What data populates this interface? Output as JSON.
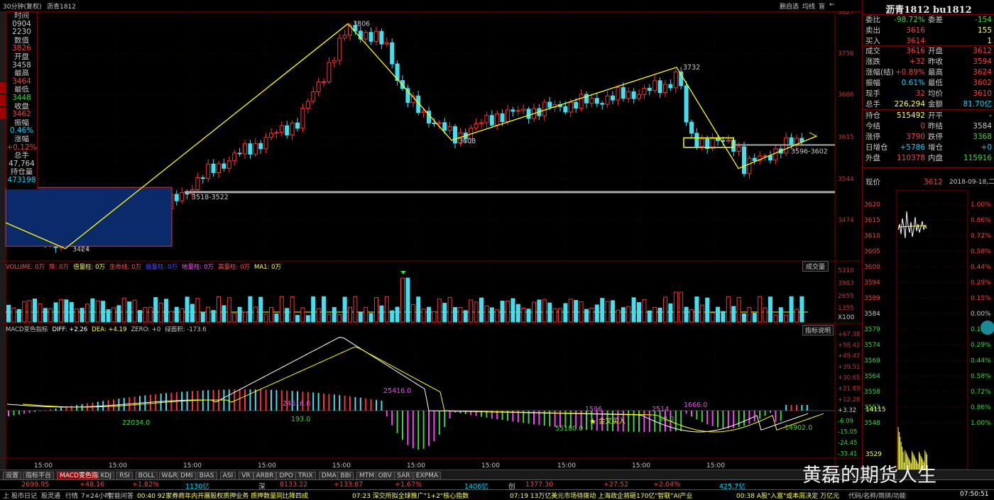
{
  "topbar": {
    "period": "30分钟(复权)",
    "symbol": "沥青1812",
    "buttons": [
      "删自选",
      "均线",
      "盲",
      "←"
    ]
  },
  "infobox": {
    "rows": [
      {
        "label": "时间",
        "value": "0904",
        "vcolor": "#c8c8c8"
      },
      {
        "label": "",
        "value": "2230",
        "vcolor": "#c8c8c8"
      },
      {
        "label": "数值",
        "value": "3826",
        "vcolor": "#ff3b3b"
      },
      {
        "label": "开盘",
        "value": "3458",
        "vcolor": "#c8c8c8"
      },
      {
        "label": "最高",
        "value": "3464",
        "vcolor": "#ff3b3b"
      },
      {
        "label": "最低",
        "value": "3448",
        "vcolor": "#38d838"
      },
      {
        "label": "收盘",
        "value": "3462",
        "vcolor": "#ff3b3b"
      },
      {
        "label": "振幅",
        "value": "0.46%",
        "vcolor": "#00d8ff"
      },
      {
        "label": "涨幅",
        "value": "+0.12%",
        "vcolor": "#ff3b3b"
      },
      {
        "label": "总手",
        "value": "47,764",
        "vcolor": "#c8c8c8"
      },
      {
        "label": "持仓量",
        "value": "473198",
        "vcolor": "#00d8ff"
      }
    ]
  },
  "price_axis": [
    "3827",
    "3756",
    "3686",
    "3615",
    "3544",
    "3474"
  ],
  "annotations": {
    "peak": "3806",
    "low1": "3424",
    "mid": "3608",
    "peak2": "3732",
    "support": "3518-3522",
    "range": "3596-3602"
  },
  "volume": {
    "legend": [
      {
        "t": "VOLUME: 0万",
        "c": "#ff5050"
      },
      {
        "t": "降: 0万",
        "c": "#ff5050"
      },
      {
        "t": "倍量柱: 0万",
        "c": "#ffff50"
      },
      {
        "t": "生命线: 0万",
        "c": "#ff5050"
      },
      {
        "t": "缩量柱: 0万",
        "c": "#5050ff"
      },
      {
        "t": "地量柱: 0万",
        "c": "#ff50ff"
      },
      {
        "t": "高量柱: 0万",
        "c": "#ff5050"
      },
      {
        "t": "MA1: 0万",
        "c": "#ffff50"
      }
    ],
    "axis": [
      "5310",
      "3983",
      "2655",
      "1355",
      "X100"
    ],
    "button": "成交量"
  },
  "macd": {
    "legend": [
      {
        "t": "MACD变色指标",
        "c": "#c8c8c8"
      },
      {
        "t": "DIFF: +2.26",
        "c": "#ffffff"
      },
      {
        "t": "DEA: +4.19",
        "c": "#ffff50"
      },
      {
        "t": "ZERO: +0",
        "c": "#c8c8c8"
      },
      {
        "t": "绿面积: -173.6",
        "c": "#c8c8c8"
      }
    ],
    "axis": [
      "+67.38",
      "+58.42",
      "+49.47",
      "+39.51",
      "+30.65",
      "+21.69",
      "+12.28",
      "+3.32",
      "-6.09",
      "-15.05",
      "-24.45",
      "-33.41"
    ],
    "labels": [
      "22034.0",
      "193.0",
      "24616.0",
      "25416.0",
      "55180.0",
      "1596",
      "98.0",
      "2514",
      "1666.0",
      "14902.0"
    ],
    "signal": "金叉买入",
    "button": "指标说明"
  },
  "time_axis": [
    "15:00",
    "15:00",
    "15:00",
    "15:00",
    "15:00",
    "15:00",
    "15:00",
    "15:00",
    "15:00",
    "15:00"
  ],
  "quote": {
    "title": "沥青1812 bu1812",
    "rows1": [
      {
        "a": "委比",
        "av": "-98.72%",
        "avc": "#38d838",
        "b": "委差",
        "bv": "-154",
        "bvc": "#38d838"
      },
      {
        "a": "卖出",
        "av": "3616",
        "avc": "#ff3b3b",
        "b": "",
        "bv": "155",
        "bvc": "#ffff50"
      },
      {
        "a": "买入",
        "av": "3614",
        "avc": "#ff3b3b",
        "b": "",
        "bv": "1",
        "bvc": "#ffff50"
      }
    ],
    "rows2": [
      {
        "a": "成交",
        "av": "3616",
        "avc": "#ff3b3b",
        "b": "开盘",
        "bv": "3612",
        "bvc": "#ff3b3b"
      },
      {
        "a": "涨跌",
        "av": "+32",
        "avc": "#ff3b3b",
        "b": "昨收",
        "bv": "3594",
        "bvc": "#ff3b3b"
      },
      {
        "a": "涨幅(结)",
        "av": "+0.89%",
        "avc": "#ff3b3b",
        "b": "最高",
        "bv": "3624",
        "bvc": "#ff3b3b"
      },
      {
        "a": "振幅",
        "av": "0.61%",
        "avc": "#00d8ff",
        "b": "最低",
        "bv": "3602",
        "bvc": "#ff3b3b"
      },
      {
        "a": "现手",
        "av": "32",
        "avc": "#ff3b3b",
        "b": "均价",
        "bv": "3610",
        "bvc": "#ff3b3b"
      },
      {
        "a": "总手",
        "av": "226,294",
        "avc": "#ffff50",
        "b": "金额",
        "bv": "81.70亿",
        "bvc": "#00d8ff"
      }
    ],
    "rows3": [
      {
        "a": "持仓",
        "av": "515492",
        "avc": "#ffff50",
        "b": "开平",
        "bv": "-",
        "bvc": "#c8c8c8"
      },
      {
        "a": "今结",
        "av": "0",
        "avc": "#ff3b3b",
        "b": "昨结",
        "bv": "3584",
        "bvc": "#c8c8c8"
      },
      {
        "a": "涨停",
        "av": "3790",
        "avc": "#ff3b3b",
        "b": "跌停",
        "bv": "3368",
        "bvc": "#38d838"
      },
      {
        "a": "日增仓",
        "av": "+5786",
        "avc": "#00d8ff",
        "b": "增仓",
        "bv": "+0",
        "bvc": "#00d8ff"
      },
      {
        "a": "外盘",
        "av": "110378",
        "avc": "#ff3b3b",
        "b": "内盘",
        "bv": "115916",
        "bvc": "#38d838"
      }
    ],
    "xianxian": "现价",
    "xianxian_val": "3612",
    "date": "2018-09-18,二",
    "mini_left": [
      "3620",
      "3615",
      "3610",
      "3605",
      "3600",
      "3594",
      "3589",
      "3584",
      "3579",
      "3574",
      "3569",
      "3564",
      "3558",
      "3553",
      "3548"
    ],
    "mini_right": [
      "1.00%",
      "0.86%",
      "0.72%",
      "0.58%",
      "0.44%",
      "0.29%",
      "0.15%",
      "0.00%",
      "0.15%",
      "0.29%",
      "0.44%",
      "0.58%",
      "0.72%",
      "0.86%",
      "1.00%"
    ],
    "mini_vol": [
      "14115",
      "3529"
    ]
  },
  "tabs": [
    "设置",
    "指标平台",
    "MACD变色指标",
    "KDJ",
    "RSI",
    "BOLL",
    "W&R",
    "DMI",
    "BIAS",
    "ASI",
    "VR",
    "ARBR",
    "DPO",
    "TRIX",
    "DMA",
    "BBI",
    "MTM",
    "OBV",
    "SAR",
    "EXPMA"
  ],
  "ticker": [
    {
      "t": "2699.95",
      "c": "#ff3b3b"
    },
    {
      "t": "+48.16",
      "c": "#ff3b3b"
    },
    {
      "t": "+1.82%",
      "c": "#ff3b3b"
    },
    {
      "t": "1130亿",
      "c": "#00d8ff"
    },
    {
      "t": "深",
      "c": "#c8c8c8"
    },
    {
      "t": "8133.22",
      "c": "#ff3b3b"
    },
    {
      "t": "+133.87",
      "c": "#ff3b3b"
    },
    {
      "t": "+1.67%",
      "c": "#ff3b3b"
    },
    {
      "t": "1406亿",
      "c": "#00d8ff"
    },
    {
      "t": "创",
      "c": "#c8c8c8"
    },
    {
      "t": "1377.30",
      "c": "#ff3b3b"
    },
    {
      "t": "+27.52",
      "c": "#ff3b3b"
    },
    {
      "t": "+2.04%",
      "c": "#ff3b3b"
    },
    {
      "t": "425.7亿",
      "c": "#00d8ff"
    }
  ],
  "status": {
    "items": [
      "上",
      "股市日记",
      "股灵通",
      "行情",
      "7×24小时",
      "智能问答"
    ],
    "news": [
      "00:40 92家券商年内开展股权质押业务 质押数量同比降四成",
      "07:23 深交所拟全球推广\"1+2\"核心指数",
      "07:19 13万亿美元市场待拨动 上海政企将砸170亿\"智联\"AI产业",
      "00:38 A股\"入富\"或本周决定 万亿元"
    ],
    "right": "代码/名称/简拼/功能",
    "clock": "07:50:51"
  },
  "watermark": "黄磊的期货人生"
}
